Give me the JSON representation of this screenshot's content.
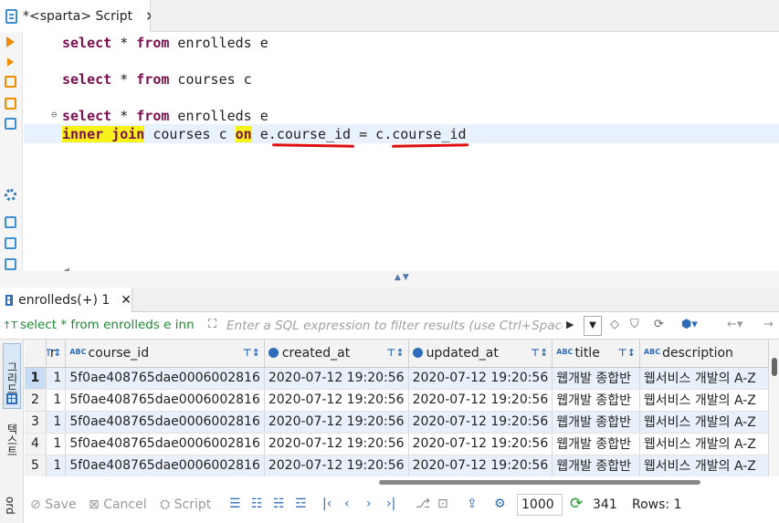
{
  "editor": {
    "tab_title": "*<sparta> Script",
    "tab_close": "✕",
    "lines": [
      {
        "kw1": "select",
        "mid1": " * ",
        "kw2": "from",
        "rest": " enrolleds e"
      },
      {
        "kw1": "select",
        "mid1": " * ",
        "kw2": "from",
        "rest": " courses c"
      },
      {
        "kw1": "select",
        "mid1": " * ",
        "kw2": "from",
        "rest": " enrolleds e"
      }
    ],
    "join_line": {
      "kw_join": "inner join",
      "part1": " courses c ",
      "kw_on": "on",
      "part2": " e.",
      "col1": "course_id",
      "part3": " = c.",
      "col2": "course_id"
    }
  },
  "results": {
    "tab_label": "enrolleds(+) 1",
    "tab_close": "✕",
    "filter_query": "select * from enrolleds e inn",
    "filter_placeholder": "Enter a SQL expression to filter results (use Ctrl+Space)",
    "vtab_grid": "그리드",
    "vtab_text": "텍스트",
    "vtab_record": "ord",
    "columns": [
      {
        "label": "r",
        "type": ""
      },
      {
        "label": "course_id",
        "type": "ABC"
      },
      {
        "label": "created_at",
        "type": "clock"
      },
      {
        "label": "updated_at",
        "type": "clock"
      },
      {
        "label": "title",
        "type": "ABC"
      },
      {
        "label": "description",
        "type": "ABC"
      }
    ],
    "rows": [
      {
        "n": "1",
        "r": "1",
        "course_id": "5f0ae408765dae0006002816",
        "created_at": "2020-07-12 19:20:56",
        "updated_at": "2020-07-12 19:20:56",
        "title": "웹개발 종합반",
        "description": "웹서비스 개발의 A-Z"
      },
      {
        "n": "2",
        "r": "1",
        "course_id": "5f0ae408765dae0006002816",
        "created_at": "2020-07-12 19:20:56",
        "updated_at": "2020-07-12 19:20:56",
        "title": "웹개발 종합반",
        "description": "웹서비스 개발의 A-Z"
      },
      {
        "n": "3",
        "r": "1",
        "course_id": "5f0ae408765dae0006002816",
        "created_at": "2020-07-12 19:20:56",
        "updated_at": "2020-07-12 19:20:56",
        "title": "웹개발 종합반",
        "description": "웹서비스 개발의 A-Z"
      },
      {
        "n": "4",
        "r": "1",
        "course_id": "5f0ae408765dae0006002816",
        "created_at": "2020-07-12 19:20:56",
        "updated_at": "2020-07-12 19:20:56",
        "title": "웹개발 종합반",
        "description": "웹서비스 개발의 A-Z"
      },
      {
        "n": "5",
        "r": "1",
        "course_id": "5f0ae408765dae0006002816",
        "created_at": "2020-07-12 19:20:56",
        "updated_at": "2020-07-12 19:20:56",
        "title": "웹개발 종합반",
        "description": "웹서비스 개발의 A-Z"
      }
    ]
  },
  "toolbar": {
    "save": "Save",
    "cancel": "Cancel",
    "script": "Script",
    "fetch_size": "1000",
    "row_count": "341",
    "rows_label": "Rows: 1"
  },
  "colors": {
    "keyword": "#7a0f4f",
    "highlight": "#f7f31a",
    "underline": "#e01010",
    "accent": "#2e6bb8",
    "query_green": "#1a8a2e"
  },
  "icons": [
    "script-icon",
    "run-icon",
    "gear-icon",
    "filter-icon",
    "refresh-icon"
  ]
}
